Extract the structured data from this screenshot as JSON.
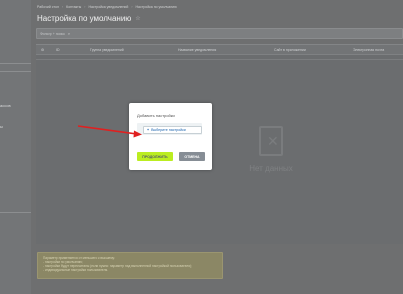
{
  "sidebar": {
    "fragments": [
      "ассов",
      "ы"
    ]
  },
  "breadcrumbs": [
    "Рабочий стол",
    "Контакты",
    "Настройка уведомлений",
    "Настройка по умолчанию"
  ],
  "page": {
    "title": "Настройка по умолчанию"
  },
  "filter": {
    "placeholder": "Фильтр + поиск"
  },
  "grid": {
    "columns": [
      "ID",
      "Группа уведомлений",
      "Название уведомления",
      "Сайт в приложении",
      "Электронная почта"
    ],
    "empty_text": "Нет данных"
  },
  "note": {
    "lines": [
      "Параметр применяется от меньшего к высшему:",
      "- настройки по умолчанию;",
      "- настройки будут пересчитаны (если нужно: параметр над выполненной настройкой пользователя);",
      "- индивидуальные настройки пользователя."
    ]
  },
  "modal": {
    "title": "Добавить настройки",
    "select_label": "Выберите настройки",
    "continue_label": "ПРОДОЛЖИТЬ",
    "cancel_label": "ОТМЕНА"
  },
  "colors": {
    "continue_button": "#bbed21",
    "cancel_button": "#868d95",
    "arrow": "#e02020",
    "link": "#2067b0"
  }
}
